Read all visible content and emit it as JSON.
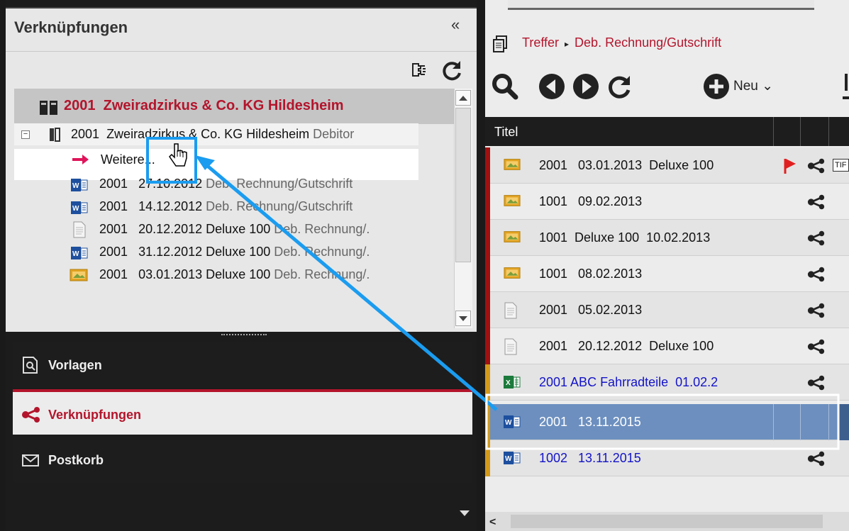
{
  "left_panel": {
    "title": "Verknüpfungen",
    "collapse_glyph": "«",
    "toolbar": {
      "plugin_icon": "plugin-icon",
      "refresh_icon": "refresh-icon"
    },
    "tree_header": {
      "number": "2001",
      "text": "Zweiradzirkus & Co. KG Hildesheim"
    },
    "tree": {
      "root": {
        "minus": "−",
        "number": "2001",
        "text": "Zweiradzirkus & Co. KG Hildesheim",
        "type": "Debitor"
      },
      "more": "Weitere...",
      "items": [
        {
          "icon": "word-icon",
          "number": "2001",
          "date": "27.10.2012",
          "title": "",
          "type": "Deb. Rechnung/Gutschrift"
        },
        {
          "icon": "word-icon",
          "number": "2001",
          "date": "14.12.2012",
          "title": "",
          "type": "Deb. Rechnung/Gutschrift"
        },
        {
          "icon": "document-icon",
          "number": "2001",
          "date": "20.12.2012",
          "title": "Deluxe 100",
          "type": "Deb. Rechnung/."
        },
        {
          "icon": "word-icon",
          "number": "2001",
          "date": "31.12.2012",
          "title": "Deluxe 100",
          "type": "Deb. Rechnung/."
        },
        {
          "icon": "image-icon",
          "number": "2001",
          "date": "03.01.2013",
          "title": "Deluxe 100",
          "type": "Deb. Rechnung/."
        }
      ]
    },
    "nav": {
      "vorlagen": "Vorlagen",
      "verknuepfungen": "Verknüpfungen",
      "postkorb": "Postkorb"
    }
  },
  "right_panel": {
    "breadcrumb": {
      "root": "Treffer",
      "separator": "▸",
      "current": "Deb. Rechnung/Gutschrift"
    },
    "toolbar": {
      "new_label": "Neu",
      "new_chevron": "⌄"
    },
    "grid": {
      "column_title": "Titel",
      "rows": [
        {
          "mark": "#a01010",
          "icon": "image-icon",
          "text": "2001   03.01.2013  Deluxe 100",
          "flag": true,
          "tif": "TIF",
          "link": false,
          "selected": false
        },
        {
          "mark": "#a01010",
          "icon": "image-icon",
          "text": "1001   09.02.2013",
          "flag": false,
          "link": false,
          "selected": false
        },
        {
          "mark": "#a01010",
          "icon": "image-icon",
          "text": "1001  Deluxe 100  10.02.2013",
          "flag": false,
          "link": false,
          "selected": false
        },
        {
          "mark": "#a01010",
          "icon": "image-icon",
          "text": "1001   08.02.2013",
          "flag": false,
          "link": false,
          "selected": false
        },
        {
          "mark": "#a01010",
          "icon": "document-icon",
          "text": "2001   05.02.2013",
          "flag": false,
          "link": false,
          "selected": false
        },
        {
          "mark": "#a01010",
          "icon": "document-icon",
          "text": "2001   20.12.2012  Deluxe 100",
          "flag": false,
          "link": false,
          "selected": false
        },
        {
          "mark": "#d39a1a",
          "icon": "excel-icon",
          "text": "2001 ABC Fahrradteile  01.02.2",
          "flag": false,
          "link": true,
          "selected": false
        },
        {
          "mark": "#d39a1a",
          "icon": "word-icon",
          "text": "2001   13.11.2015",
          "flag": false,
          "link": false,
          "selected": true
        },
        {
          "mark": "#d39a1a",
          "icon": "word-icon",
          "text": "1002   13.11.2015",
          "flag": false,
          "link": true,
          "selected": false
        }
      ]
    },
    "hscroll_left": "<"
  },
  "colors": {
    "accent_red": "#b3152c",
    "selection_blue": "#6c8fbf",
    "annotation_blue": "#1a9cf0",
    "link_blue": "#1414c8"
  }
}
